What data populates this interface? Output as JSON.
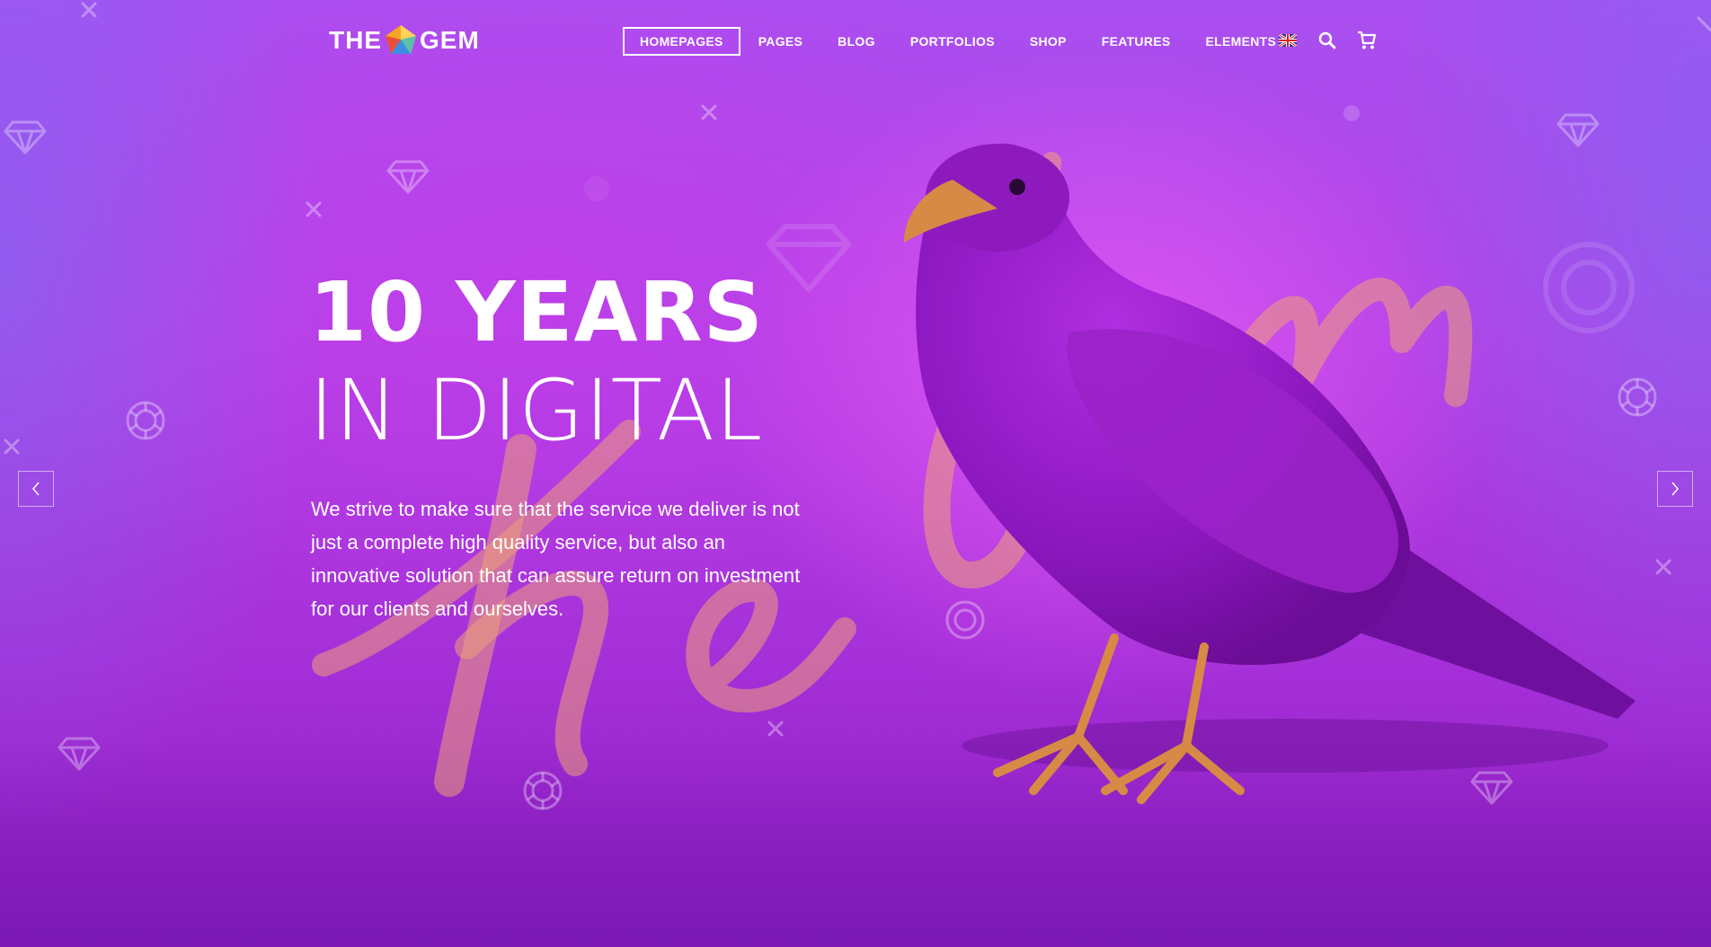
{
  "logo": {
    "left": "THE",
    "right": "GEM"
  },
  "nav": {
    "items": [
      {
        "label": "HOMEPAGES",
        "active": true
      },
      {
        "label": "PAGES",
        "active": false
      },
      {
        "label": "BLOG",
        "active": false
      },
      {
        "label": "PORTFOLIOS",
        "active": false
      },
      {
        "label": "SHOP",
        "active": false
      },
      {
        "label": "FEATURES",
        "active": false
      },
      {
        "label": "ELEMENTS",
        "active": false
      }
    ],
    "icons": [
      "uk-flag-icon",
      "search-icon",
      "cart-icon"
    ]
  },
  "hero": {
    "title": "10 YEARS",
    "subtitle": "IN DIGITAL",
    "text": "We strive to make sure that the service we deliver is not just a complete high quality service, but also an innovative solution that can assure return on investment for our clients and ourselves."
  },
  "slider": {
    "prev_icon": "chevron-left-icon",
    "next_icon": "chevron-right-icon"
  },
  "colors": {
    "bg_top": "#a94ff0",
    "bg_mid": "#b441e6",
    "brush": "#e9a07a",
    "bird": "#8a16b8",
    "beak": "#d68a45"
  }
}
